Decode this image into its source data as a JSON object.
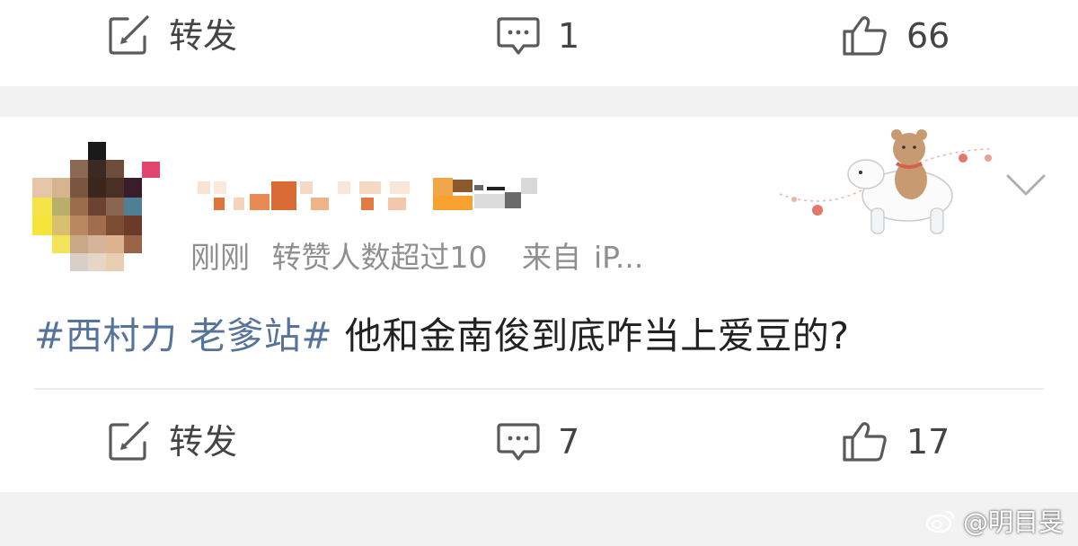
{
  "top_action_bar": {
    "repost_label": "转发",
    "comment_count": "1",
    "like_count": "66"
  },
  "post": {
    "time": "刚刚",
    "repost_note": "转赞人数超过10",
    "source_prefix": "来自",
    "source_device": "iP...",
    "topic": "#西村力 老爹站#",
    "text": " 他和金南俊到底咋当上爱豆的?",
    "actions": {
      "repost_label": "转发",
      "comment_count": "7",
      "like_count": "17"
    }
  },
  "watermark": {
    "handle": "@明目旻"
  },
  "colors": {
    "topic_link": "#56739a",
    "meta_text": "#8f8f8f",
    "separator_band": "#f2f2f2",
    "icon_gray": "#5a5a5a"
  },
  "icons": [
    "repost-icon",
    "comment-icon",
    "like-icon",
    "chevron-down-icon",
    "weibo-logo-icon"
  ]
}
